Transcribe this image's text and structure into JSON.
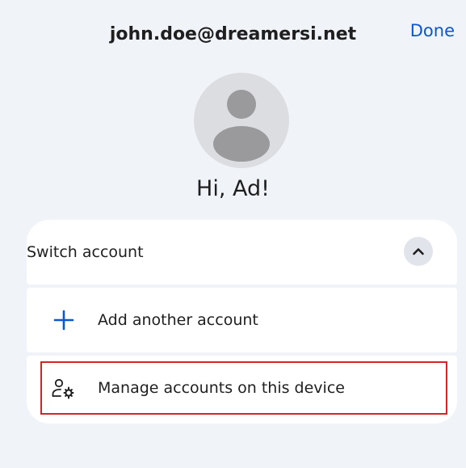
{
  "header": {
    "email": "john.doe@dreamersi.net",
    "done_label": "Done"
  },
  "profile": {
    "greeting": "Hi, Ad!",
    "avatar_icon": "person-silhouette-icon"
  },
  "switch_account": {
    "label": "Switch account",
    "expanded": true,
    "chevron_icon": "chevron-up-icon"
  },
  "menu": {
    "add_account": {
      "label": "Add another account",
      "icon": "plus-icon",
      "icon_color": "#0b57d0"
    },
    "manage_accounts": {
      "label": "Manage accounts on this device",
      "icon": "manage-accounts-icon",
      "highlighted": true,
      "highlight_color": "#d3242a"
    }
  },
  "colors": {
    "background": "#f0f4f9",
    "accent": "#0b57d0",
    "card": "#ffffff",
    "text": "#1f1f1f"
  }
}
